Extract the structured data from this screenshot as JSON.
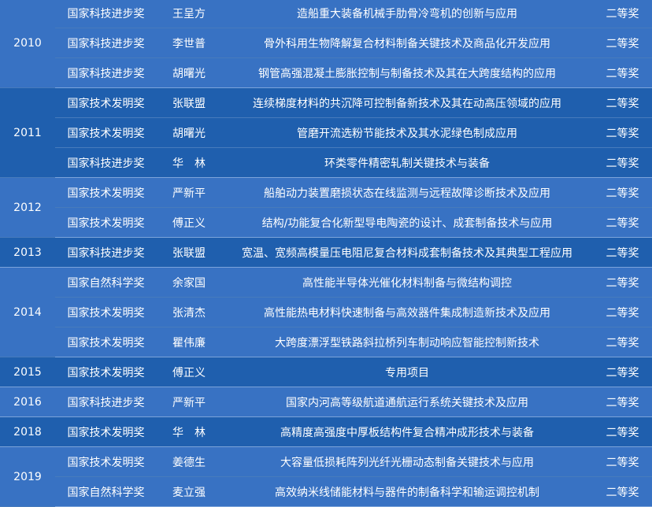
{
  "groups": [
    {
      "year": "2010",
      "rows": [
        {
          "type": "国家科技进步奖",
          "person": "王呈方",
          "project": "造船重大装备机械手肋骨冷弯机的创新与应用",
          "grade": "二等奖"
        },
        {
          "type": "国家科技进步奖",
          "person": "李世普",
          "project": "骨外科用生物降解复合材料制备关键技术及商品化开发应用",
          "grade": "二等奖"
        },
        {
          "type": "国家科技进步奖",
          "person": "胡曙光",
          "project": "钢管高强混凝土膨胀控制与制备技术及其在大跨度结构的应用",
          "grade": "二等奖"
        }
      ]
    },
    {
      "year": "2011",
      "rows": [
        {
          "type": "国家技术发明奖",
          "person": "张联盟",
          "project": "连续梯度材料的共沉降可控制备新技术及其在动高压领域的应用",
          "grade": "二等奖"
        },
        {
          "type": "国家技术发明奖",
          "person": "胡曙光",
          "project": "管磨开流选粉节能技术及其水泥绿色制成应用",
          "grade": "二等奖"
        },
        {
          "type": "国家科技进步奖",
          "person": "华　林",
          "project": "环类零件精密轧制关键技术与装备",
          "grade": "二等奖"
        }
      ]
    },
    {
      "year": "2012",
      "rows": [
        {
          "type": "国家技术发明奖",
          "person": "严新平",
          "project": "船舶动力装置磨损状态在线监测与远程故障诊断技术及应用",
          "grade": "二等奖"
        },
        {
          "type": "国家技术发明奖",
          "person": "傅正义",
          "project": "结构/功能复合化新型导电陶瓷的设计、成套制备技术与应用",
          "grade": "二等奖"
        }
      ]
    },
    {
      "year": "2013",
      "rows": [
        {
          "type": "国家科技进步奖",
          "person": "张联盟",
          "project": "宽温、宽频高模量压电阻尼复合材料成套制备技术及其典型工程应用",
          "grade": "二等奖"
        }
      ]
    },
    {
      "year": "2014",
      "rows": [
        {
          "type": "国家自然科学奖",
          "person": "余家国",
          "project": "高性能半导体光催化材料制备与微结构调控",
          "grade": "二等奖"
        },
        {
          "type": "国家技术发明奖",
          "person": "张清杰",
          "project": "高性能热电材料快速制备与高效器件集成制造新技术及应用",
          "grade": "二等奖"
        },
        {
          "type": "国家技术发明奖",
          "person": "瞿伟廉",
          "project": "大跨度漂浮型铁路斜拉桥列车制动响应智能控制新技术",
          "grade": "二等奖"
        }
      ]
    },
    {
      "year": "2015",
      "rows": [
        {
          "type": "国家技术发明奖",
          "person": "傅正义",
          "project": "专用项目",
          "grade": "二等奖"
        }
      ]
    },
    {
      "year": "2016",
      "rows": [
        {
          "type": "国家科技进步奖",
          "person": "严新平",
          "project": "国家内河高等级航道通航运行系统关键技术及应用",
          "grade": "二等奖"
        }
      ]
    },
    {
      "year": "2018",
      "rows": [
        {
          "type": "国家技术发明奖",
          "person": "华　林",
          "project": "高精度高强度中厚板结构件复合精冲成形技术与装备",
          "grade": "二等奖"
        }
      ]
    },
    {
      "year": "2019",
      "rows": [
        {
          "type": "国家技术发明奖",
          "person": "姜德生",
          "project": "大容量低损耗阵列光纤光栅动态制备关键技术与应用",
          "grade": "二等奖"
        },
        {
          "type": "国家自然科学奖",
          "person": "麦立强",
          "project": "高效纳米线储能材料与器件的制备科学和输运调控机制",
          "grade": "二等奖"
        }
      ]
    }
  ]
}
